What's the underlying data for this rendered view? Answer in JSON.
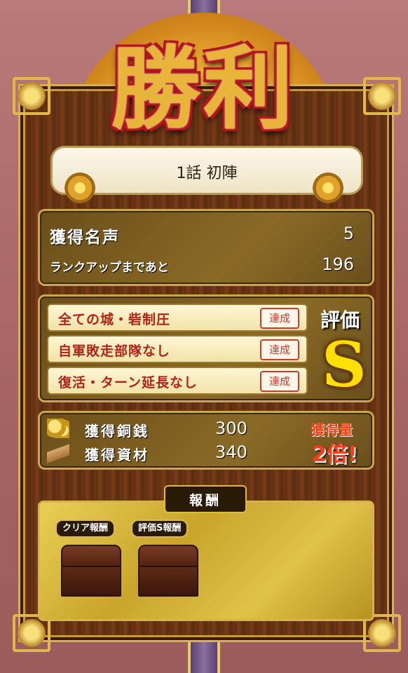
{
  "victory_title": "勝利",
  "stage_title": "1話 初陣",
  "fame": {
    "label": "獲得名声",
    "value": "5",
    "rank_label": "ランクアップまであと",
    "rank_value": "196"
  },
  "conditions": [
    {
      "label": "全ての城・砦制圧",
      "stamp": "達成"
    },
    {
      "label": "自軍敗走部隊なし",
      "stamp": "達成"
    },
    {
      "label": "復活・ターン延長なし",
      "stamp": "達成"
    }
  ],
  "evaluation": {
    "label": "評価",
    "grade": "S"
  },
  "resources": [
    {
      "label": "獲得銅銭",
      "value": "300",
      "icon": "coins-icon"
    },
    {
      "label": "獲得資材",
      "value": "340",
      "icon": "lumber-icon"
    }
  ],
  "bonus": {
    "label": "獲得量",
    "value": "2倍!"
  },
  "rewards": {
    "header": "報酬",
    "tags": [
      "クリア報酬",
      "評価S報酬"
    ],
    "items": [
      "treasure-chest-icon",
      "treasure-chest-icon"
    ]
  },
  "colors": {
    "accent_gold": "#e0b84c",
    "wood": "#6b3615",
    "grade": "#ffe000",
    "stamp": "#c93b2e"
  }
}
